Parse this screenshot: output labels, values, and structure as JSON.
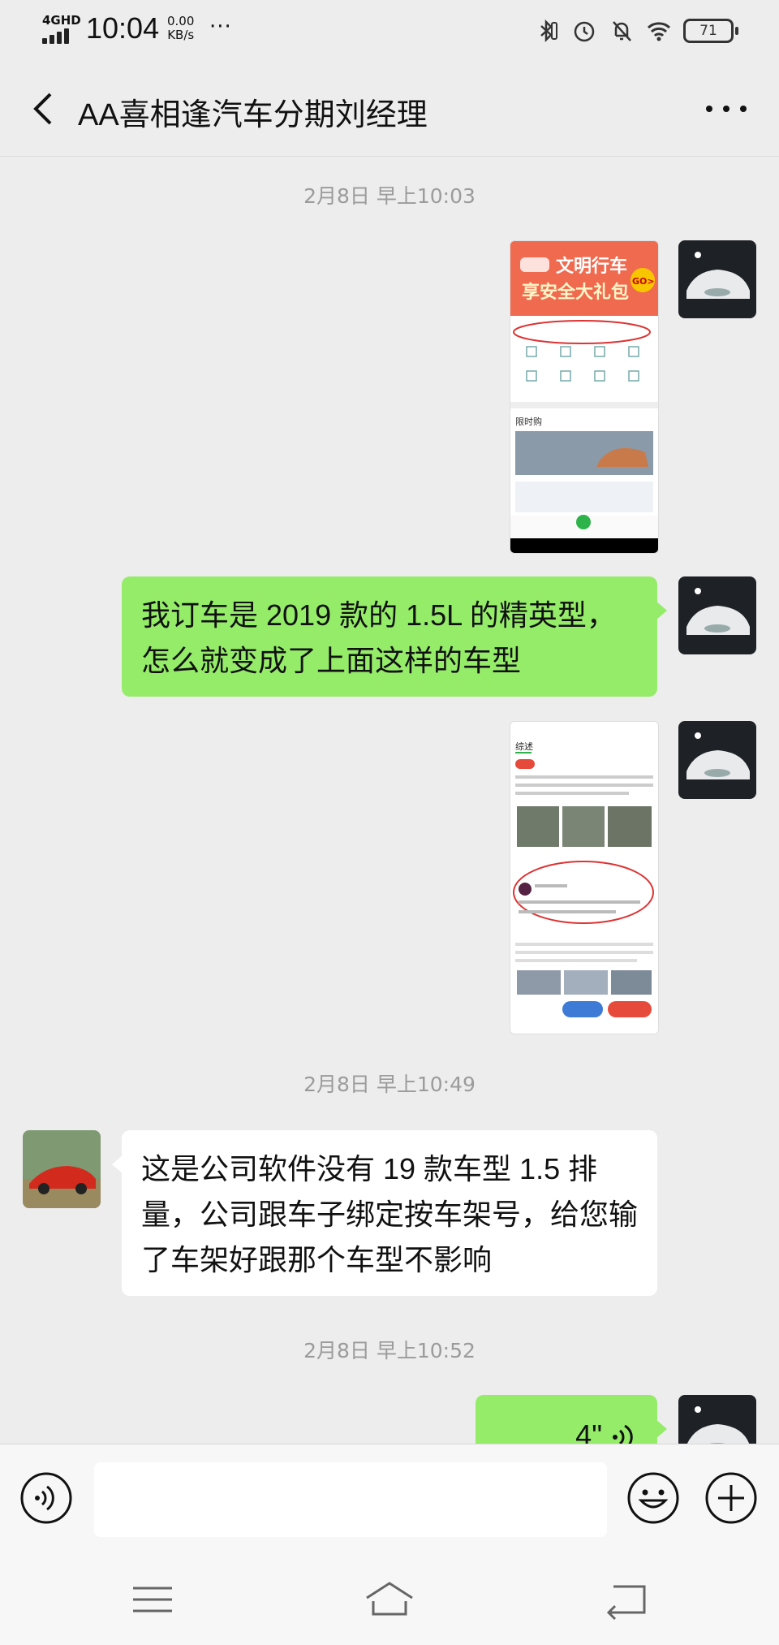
{
  "status_bar": {
    "network": "4GHD",
    "time": "10:04",
    "speed_value": "0.00",
    "speed_unit": "KB/s",
    "more": "···",
    "battery": "71"
  },
  "header": {
    "back_icon": "chevron-left-icon",
    "title": "AA喜相逢汽车分期刘经理",
    "more_icon": "more-dots-icon"
  },
  "messages": {
    "ts1": "2月8日 早上10:03",
    "msg2": "我订车是 2019 款的 1.5L 的精英型，怎么就变成了上面这样的车型",
    "ts2": "2月8日 早上10:49",
    "msg4": "这是公司软件没有 19 款车型 1.5 排量，公司跟车子绑定按车架号，给您输了车架好跟那个车型不影响",
    "ts3": "2月8日 早上10:52",
    "voice_duration": "4\""
  },
  "shot1": {
    "banner_line1": "文明行车",
    "banner_line2": "享安全大礼包",
    "go": "GO>",
    "section": "限时购"
  },
  "shot2": {
    "tab_active": "综述"
  },
  "input_bar": {
    "voice_icon": "voice-mode-icon",
    "emoji_icon": "emoji-icon",
    "plus_icon": "plus-icon",
    "placeholder": ""
  },
  "nav_bar": {
    "menu_icon": "menu-icon",
    "home_icon": "home-icon",
    "back_icon": "back-icon"
  }
}
